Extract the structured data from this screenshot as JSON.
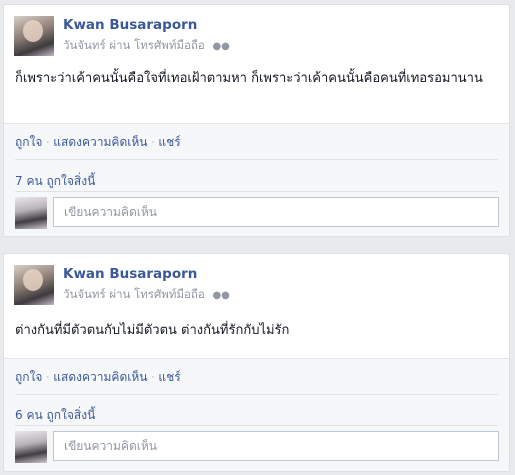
{
  "posts": [
    {
      "author": "Kwan Busaraporn",
      "meta": "วันจันทร์ ผ่าน โทรศัพท์มือถือ",
      "privacy_icon": "friends-icon",
      "text": "ก็เพราะว่าเค้าคนนั้นคือใจที่เทอเฝ้าตามหา ก็เพราะว่าเค้าคนนั้นคือคนที่เทอรอมานาน",
      "actions": {
        "like": "ถูกใจ",
        "comment": "แสดงความคิดเห็น",
        "share": "แชร์"
      },
      "likes": "7 คน ถูกใจสิ่งนี้",
      "comment_placeholder": "เขียนความคิดเห็น"
    },
    {
      "author": "Kwan Busaraporn",
      "meta": "วันจันทร์ ผ่าน โทรศัพท์มือถือ",
      "privacy_icon": "friends-icon",
      "text": "ต่างกันที่มีตัวตนกับไม่มีตัวตน ต่างกันที่รักกับไม่รัก",
      "actions": {
        "like": "ถูกใจ",
        "comment": "แสดงความคิดเห็น",
        "share": "แชร์"
      },
      "likes": "6 คน ถูกใจสิ่งนี้",
      "comment_placeholder": "เขียนความคิดเห็น"
    }
  ],
  "colors": {
    "link": "#3b5998",
    "muted": "#9197a3",
    "background": "#e9eaed"
  }
}
